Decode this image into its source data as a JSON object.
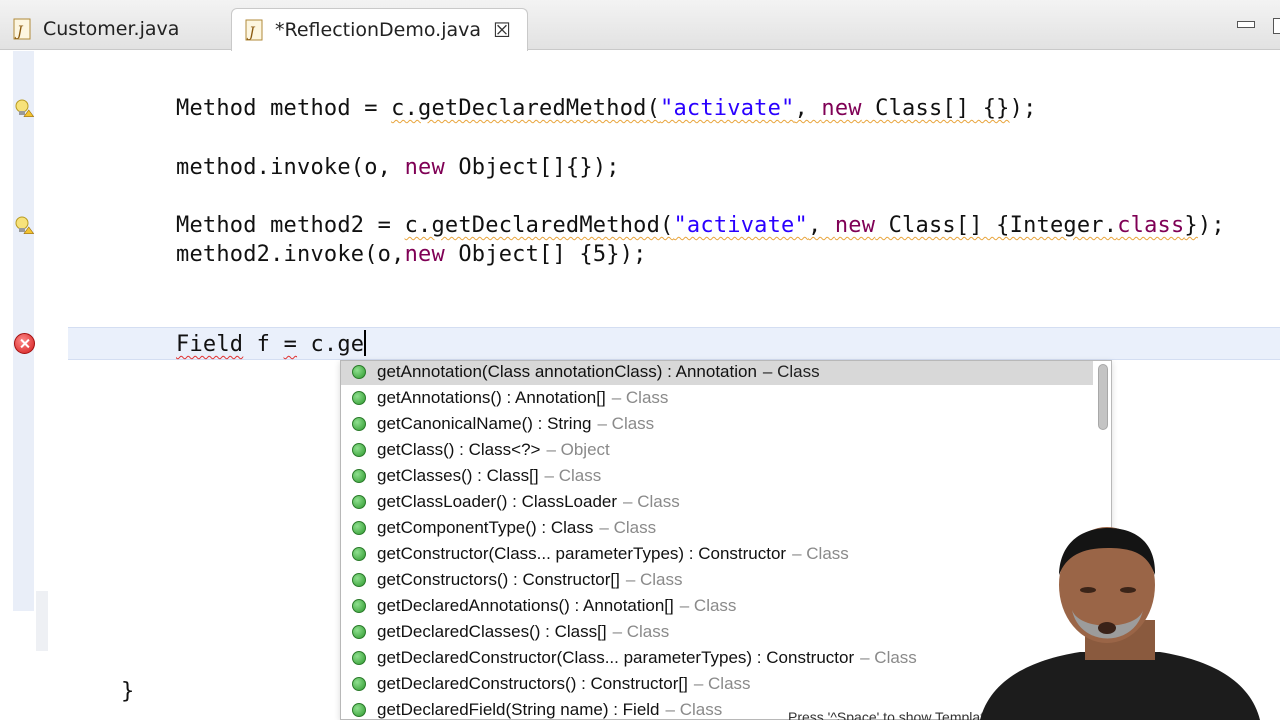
{
  "tabs": [
    {
      "label": "Customer.java",
      "active": false
    },
    {
      "label": "*ReflectionDemo.java",
      "active": true
    }
  ],
  "tab_close_symbol": "☒",
  "code": {
    "line1": {
      "t1": "Method method = ",
      "t2": "c.getDeclaredMethod(",
      "str": "\"activate\"",
      "t3": ", ",
      "kw": "new",
      "t4": " Class[] {}",
      "t5": ");"
    },
    "line2": {
      "t1": "method.invoke(o, ",
      "kw": "new",
      "t2": " Object[]{});"
    },
    "line3": {
      "t1": "Method method2 = ",
      "t2": "c.getDeclaredMethod(",
      "str": "\"activate\"",
      "t3": ", ",
      "kw1": "new",
      "t4": " Class[] {Integer.",
      "kw2": "class",
      "t5": "}",
      "t6": ");"
    },
    "line4": {
      "t1": "method2.invoke(o,",
      "kw": "new",
      "t2": " Object[] {5});"
    },
    "line5": {
      "t1": "Field",
      "t2": " f ",
      "t3": "=",
      "t4": " c.ge"
    },
    "closing_brace": "}"
  },
  "autocomplete": {
    "items": [
      {
        "sig": "getAnnotation(Class annotationClass) : Annotation",
        "owner": "– Class"
      },
      {
        "sig": "getAnnotations() : Annotation[]",
        "owner": "– Class"
      },
      {
        "sig": "getCanonicalName() : String",
        "owner": "– Class"
      },
      {
        "sig": "getClass() : Class<?>",
        "owner": "– Object"
      },
      {
        "sig": "getClasses() : Class[]",
        "owner": "– Class"
      },
      {
        "sig": "getClassLoader() : ClassLoader",
        "owner": "– Class"
      },
      {
        "sig": "getComponentType() : Class",
        "owner": "– Class"
      },
      {
        "sig": "getConstructor(Class... parameterTypes) : Constructor",
        "owner": "– Class"
      },
      {
        "sig": "getConstructors() : Constructor[]",
        "owner": "– Class"
      },
      {
        "sig": "getDeclaredAnnotations() : Annotation[]",
        "owner": "– Class"
      },
      {
        "sig": "getDeclaredClasses() : Class[]",
        "owner": "– Class"
      },
      {
        "sig": "getDeclaredConstructor(Class... parameterTypes) : Constructor",
        "owner": "– Class"
      },
      {
        "sig": "getDeclaredConstructors() : Constructor[]",
        "owner": "– Class"
      },
      {
        "sig": "getDeclaredField(String name) : Field",
        "owner": "– Class"
      }
    ],
    "footer": "Press '^Space' to show Template Proposals"
  },
  "colors": {
    "keyword": "#7f0055",
    "string": "#2a00ff",
    "error": "#d21b1b",
    "method-dot": "#2f9a2f"
  },
  "icons": [
    "java-file-icon",
    "close-tab-icon",
    "minimize-icon",
    "maximize-icon",
    "warning-lightbulb-icon",
    "error-icon",
    "public-method-icon"
  ]
}
